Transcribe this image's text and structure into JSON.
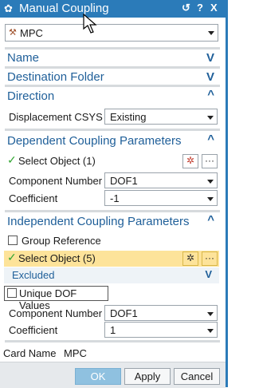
{
  "window": {
    "title": "Manual Coupling",
    "reset_glyph": "↺",
    "help_glyph": "?",
    "close_glyph": "X",
    "colors": {
      "titlebar": "#2b7bb9",
      "section": "#1f5f99",
      "highlight": "#fde39a"
    }
  },
  "type_select": {
    "value": "MPC",
    "icon": "mpc-icon"
  },
  "sections": {
    "name": "Name",
    "destination": "Destination Folder",
    "direction": "Direction",
    "dependent": "Dependent Coupling Parameters",
    "independent": "Independent Coupling Parameters",
    "excluded": "Excluded"
  },
  "direction": {
    "label": "Displacement CSYS",
    "value": "Existing"
  },
  "dependent": {
    "select_label": "Select Object (1)",
    "component_label": "Component Number",
    "component_value": "DOF1",
    "coefficient_label": "Coefficient",
    "coefficient_value": "-1"
  },
  "independent": {
    "group_ref_label": "Group Reference",
    "select_label": "Select Object (5)",
    "unique_label": "Unique DOF Values",
    "component_label": "Component Number",
    "component_value": "DOF1",
    "coefficient_label": "Coefficient",
    "coefficient_value": "1"
  },
  "card": {
    "label": "Card Name",
    "value": "MPC"
  },
  "buttons": {
    "ok": "OK",
    "apply": "Apply",
    "cancel": "Cancel",
    "more": "···"
  }
}
